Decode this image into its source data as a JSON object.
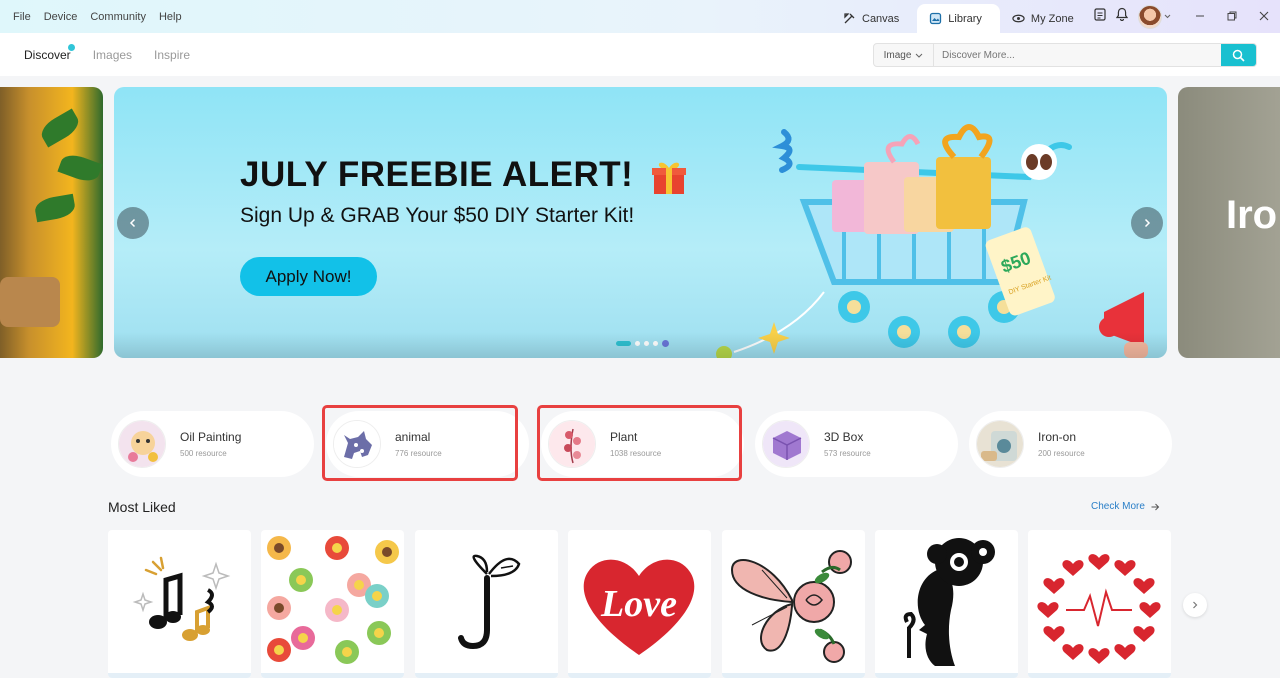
{
  "menu": [
    "File",
    "Device",
    "Community",
    "Help"
  ],
  "app_tabs": [
    {
      "label": "Canvas",
      "icon": "canvas-icon"
    },
    {
      "label": "Library",
      "icon": "library-icon",
      "active": true
    },
    {
      "label": "My Zone",
      "icon": "my-zone-icon"
    }
  ],
  "nav": {
    "tabs": [
      "Discover",
      "Images",
      "Inspire"
    ],
    "active": "Discover"
  },
  "search": {
    "type": "Image",
    "placeholder": "Discover More..."
  },
  "banner": {
    "side_right_text": "Iro",
    "title": "JULY FREEBIE ALERT!",
    "subtitle": "Sign Up & GRAB Your $50 DIY Starter Kit!",
    "cta": "Apply Now!",
    "ticket_text": "$50",
    "ticket_sub": "DIY Starter Kit",
    "slide_count": 5,
    "active_slide": 1
  },
  "categories": [
    {
      "name": "Oil Painting",
      "count": "500 resource",
      "highlighted": false
    },
    {
      "name": "animal",
      "count": "776 resource",
      "highlighted": true
    },
    {
      "name": "Plant",
      "count": "1038 resource",
      "highlighted": true
    },
    {
      "name": "3D Box",
      "count": "573 resource",
      "highlighted": false
    },
    {
      "name": "Iron-on",
      "count": "200 resource",
      "highlighted": false
    }
  ],
  "most_liked": {
    "title": "Most Liked",
    "check_more": "Check More",
    "cards": [
      {
        "design": "music-notes"
      },
      {
        "design": "daisy-pattern"
      },
      {
        "design": "butterfly-letter-j"
      },
      {
        "design": "love-heart",
        "text": "Love"
      },
      {
        "design": "butterfly-roses"
      },
      {
        "design": "floral-woman-silhouette"
      },
      {
        "design": "heartbeat-hearts"
      }
    ]
  },
  "colors": {
    "accent": "#19c0d0",
    "highlight": "#e84040",
    "link": "#2a7fc8",
    "love_red": "#d8262f"
  }
}
